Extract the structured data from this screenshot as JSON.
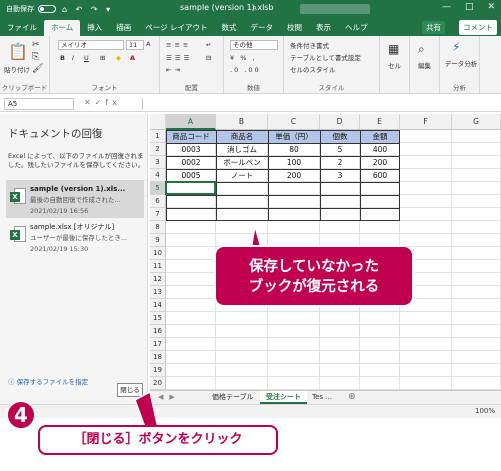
{
  "titlebar": {
    "autosave_label": "自動保存",
    "autosave_state": "オフ",
    "title": "sample (version 1).xlsb",
    "search_icon": "search-icon",
    "minimize": "—",
    "maximize": "□",
    "close": "✕"
  },
  "ribbon_tabs": {
    "items": [
      "ファイル",
      "ホーム",
      "挿入",
      "描画",
      "ページ レイアウト",
      "数式",
      "データ",
      "校閲",
      "表示",
      "ヘルプ"
    ],
    "active": "ホーム",
    "share": "共有",
    "comment": "コメント"
  },
  "ribbon": {
    "paste": "貼り付け",
    "clipboard": "クリップボード",
    "font_name": "メイリオ",
    "font_size": "11",
    "font_group": "フォント",
    "align_group": "配置",
    "number_format": "その他",
    "number_group": "数値",
    "cond_format": "条件付き書式",
    "table_format": "テーブルとして書式設定",
    "cell_style": "セルのスタイル",
    "style_group": "スタイル",
    "cells": "セル",
    "editing": "編集",
    "data_analysis": "データ分析",
    "analysis_group": "分析"
  },
  "formula_bar": {
    "name_box": "A5",
    "fx": "fx"
  },
  "recovery_pane": {
    "title": "ドキュメントの回復",
    "description": "Excel によって、以下のファイルが回復されました。残したいファイルを保存してください。",
    "files": [
      {
        "name": "sample (version 1).xls...",
        "desc": "最後の自動回復で作成された...",
        "date": "2021/02/19 16:56"
      },
      {
        "name": "sample.xlsx [オリジナル]",
        "desc": "ユーザーが最後に保存したとき...",
        "date": "2021/02/19 15:30"
      }
    ],
    "link": "保存するファイルを指定",
    "close_button": "閉じる"
  },
  "sheet": {
    "columns": [
      "A",
      "B",
      "C",
      "D",
      "E",
      "F",
      "G"
    ],
    "rows": [
      "1",
      "2",
      "3",
      "4",
      "5",
      "6",
      "7",
      "8",
      "9",
      "10",
      "11",
      "12",
      "13",
      "14",
      "15",
      "16",
      "17",
      "18",
      "19",
      "20"
    ],
    "active_cell": "A5",
    "table": {
      "headers": [
        "商品コード",
        "商品名",
        "単価（円）",
        "個数",
        "金額"
      ],
      "rows": [
        [
          "0003",
          "消しゴム",
          "80",
          "5",
          "400"
        ],
        [
          "0002",
          "ボールペン",
          "100",
          "2",
          "200"
        ],
        [
          "0005",
          "ノート",
          "200",
          "3",
          "600"
        ]
      ]
    }
  },
  "sheet_tabs": {
    "items": [
      "価格テーブル",
      "受注シート",
      "Tes ..."
    ],
    "active": "受注シート"
  },
  "status_bar": {
    "zoom": "100%"
  },
  "annotations": {
    "callout_main_line1": "保存していなかった",
    "callout_main_line2": "ブックが復元される",
    "step_number": "4",
    "step_label": "［閉じる］ボタンをクリック",
    "accent_color": "#c0004f",
    "excel_green": "#217346"
  }
}
